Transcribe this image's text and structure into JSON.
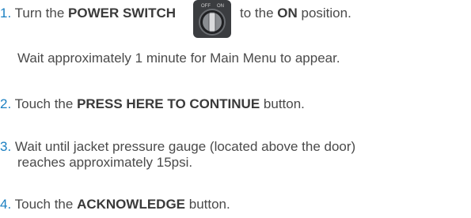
{
  "steps": [
    {
      "num": "1.",
      "parts": [
        "Turn the ",
        "POWER SWITCH",
        "to the ",
        "ON",
        " position."
      ],
      "note": "Wait approximately 1 minute for Main Menu to appear.",
      "switch": {
        "icon": "power-switch-icon",
        "off_label": "OFF",
        "on_label": "ON"
      }
    },
    {
      "num": "2.",
      "parts": [
        "Touch the ",
        "PRESS HERE TO CONTINUE",
        " button."
      ]
    },
    {
      "num": "3.",
      "line1": "Wait until jacket pressure gauge (located above the door)",
      "line2": "reaches approximately 15psi."
    },
    {
      "num": "4.",
      "parts": [
        "Touch the ",
        "ACKNOWLEDGE",
        " button."
      ]
    }
  ],
  "colors": {
    "number": "#1a7fc1",
    "text": "#4a4a4a"
  }
}
